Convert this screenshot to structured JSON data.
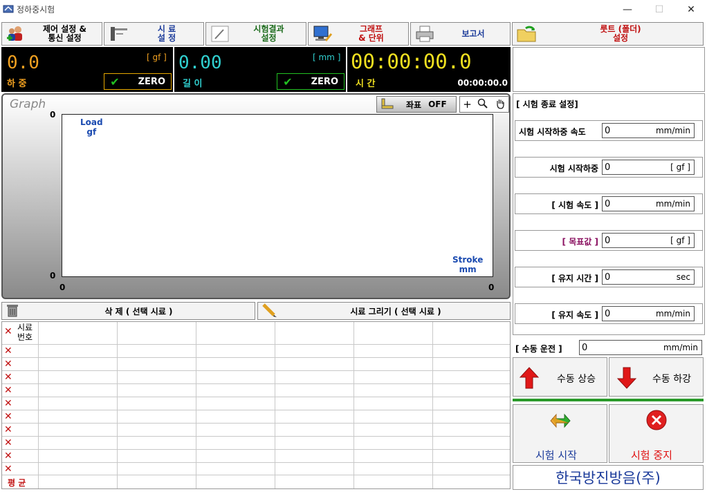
{
  "window": {
    "title": "정하중시험",
    "minimize": "—",
    "maximize": "☐",
    "close": "✕"
  },
  "toolbar": [
    {
      "label1": "제어 설정 &",
      "label2": "통신 설정",
      "color": "#000000"
    },
    {
      "label1": "시   료",
      "label2": "설   정",
      "color": "#1a3a9a"
    },
    {
      "label1": "시험결과",
      "label2": "설정",
      "color": "#1a6a1a"
    },
    {
      "label1": "그래프",
      "label2": "& 단위",
      "color": "#c01010"
    },
    {
      "label1": "보고서",
      "label2": "",
      "color": "#1a3a9a"
    },
    {
      "label1": "룻트 (폴더)",
      "label2": "설정",
      "color": "#c01010"
    }
  ],
  "load": {
    "value": "0.0",
    "unit": "[ gf ]",
    "label": "하 중",
    "zero": "ZERO",
    "color": "#f0a020"
  },
  "stroke": {
    "value": "0.00",
    "unit": "[ mm ]",
    "label": "길 이",
    "zero": "ZERO",
    "color": "#30d0d0"
  },
  "time": {
    "value": "00:00:00.0",
    "label": "시 간",
    "small": "00:00:00.0",
    "color": "#f0e020"
  },
  "graph": {
    "title": "Graph",
    "coord_label": "좌표",
    "coord_state": "OFF",
    "y_label1": "Load",
    "y_label2": "gf",
    "x_label1": "Stroke",
    "x_label2": "mm",
    "y_tick_top": "0",
    "y_tick_bottom": "0",
    "x_tick_left": "0",
    "x_tick_right": "0",
    "plus": "+"
  },
  "actions": {
    "delete_label": "삭 제 ( 선택 시료 )",
    "draw_label": "시료 그리기 ( 선택 시료 )"
  },
  "table": {
    "header1": "시료",
    "header2": "번호",
    "rows": 10,
    "average": "평 균"
  },
  "settings": {
    "section": "[ 시험 종료 설정]",
    "items": [
      {
        "label": "시험 시작하중 속도",
        "value": "0",
        "unit": "mm/min",
        "color": "#000000"
      },
      {
        "label": "시험 시작하중",
        "value": "0",
        "unit": "[ gf ]",
        "color": "#000000"
      },
      {
        "label": "[ 시험 속도 ]",
        "value": "0",
        "unit": "mm/min",
        "color": "#000000"
      },
      {
        "label": "[ 목표값 ]",
        "value": "0",
        "unit": "[ gf ]",
        "color": "#8a1060"
      },
      {
        "label": "[ 유지 시간 ]",
        "value": "0",
        "unit": "sec",
        "color": "#000000"
      },
      {
        "label": "[ 유지 속도 ]",
        "value": "0",
        "unit": "mm/min",
        "color": "#000000"
      }
    ]
  },
  "manual": {
    "label": "[ 수동 운전 ]",
    "value": "0",
    "unit": "mm/min",
    "up": "수동 상승",
    "down": "수동 하강"
  },
  "run": {
    "start": "시험 시작",
    "stop": "시험 중지"
  },
  "company": "한국방진방음(주)"
}
